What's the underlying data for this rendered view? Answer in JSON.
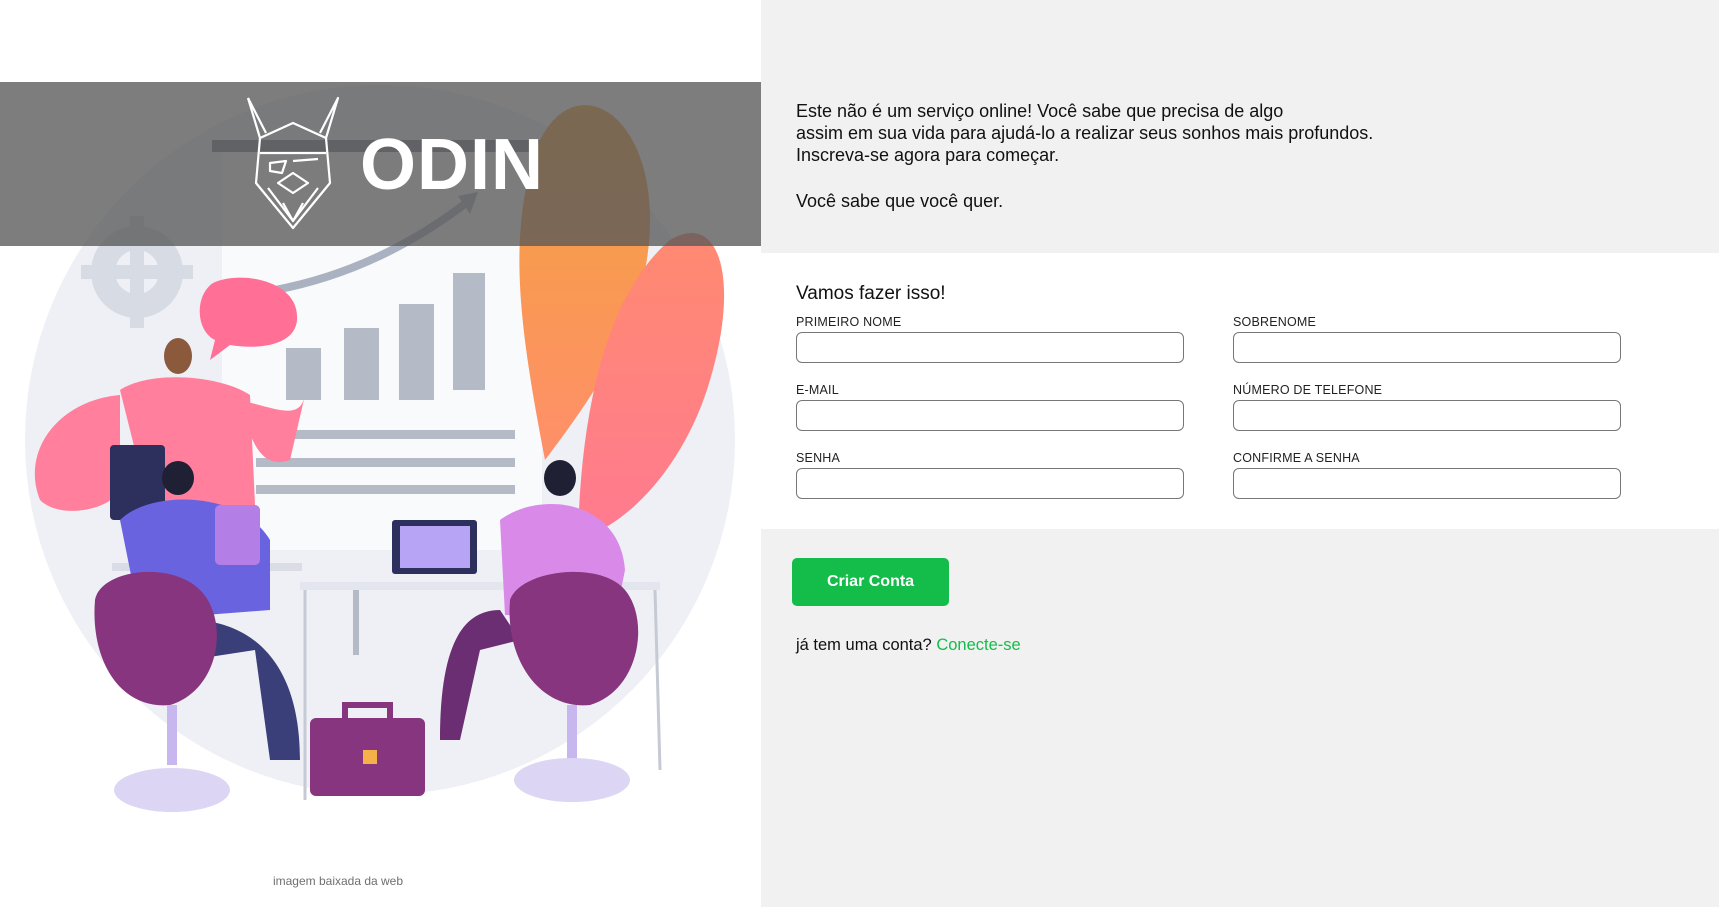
{
  "brand": {
    "name": "ODIN"
  },
  "illustration": {
    "credit": "imagem baixada da web"
  },
  "intro": {
    "lines": [
      "Este não é um serviço online! Você sabe que precisa de algo",
      "assim em sua vida para ajudá-lo a realizar seus sonhos mais profundos.",
      "Inscreva-se agora para começar."
    ],
    "tagline": "Você sabe que você quer."
  },
  "form": {
    "title": "Vamos fazer isso!",
    "fields": {
      "first_name": {
        "label": "PRIMEIRO NOME",
        "value": ""
      },
      "last_name": {
        "label": "SOBRENOME",
        "value": ""
      },
      "email": {
        "label": "E-MAIL",
        "value": ""
      },
      "phone": {
        "label": "NÚMERO DE TELEFONE",
        "value": ""
      },
      "password": {
        "label": "SENHA",
        "value": ""
      },
      "confirm_password": {
        "label": "CONFIRME A SENHA",
        "value": ""
      }
    }
  },
  "actions": {
    "submit_label": "Criar Conta",
    "login_prompt": "já tem uma conta?",
    "login_link": "Conecte-se"
  },
  "colors": {
    "accent": "#14bd49",
    "panel_background": "#f0f1f0",
    "logo_band": "#585858"
  }
}
